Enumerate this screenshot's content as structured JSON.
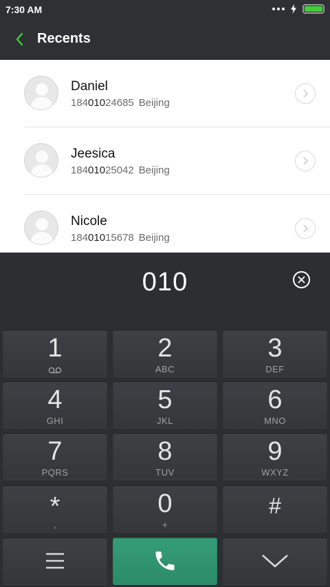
{
  "status": {
    "time": "7:30 AM",
    "battery_level": 1.0
  },
  "header": {
    "title": "Recents"
  },
  "contacts": [
    {
      "name": "Daniel",
      "num_prefix": "184",
      "num_match": "010",
      "num_suffix": "24685",
      "location": "Beijing"
    },
    {
      "name": "Jeesica",
      "num_prefix": "184",
      "num_match": "010",
      "num_suffix": "25042",
      "location": "Beijing"
    },
    {
      "name": "Nicole",
      "num_prefix": "184",
      "num_match": "010",
      "num_suffix": "15678",
      "location": "Beijing"
    }
  ],
  "dialer": {
    "number": "010"
  },
  "keys": [
    {
      "digit": "1",
      "letters": ""
    },
    {
      "digit": "2",
      "letters": "ABC"
    },
    {
      "digit": "3",
      "letters": "DEF"
    },
    {
      "digit": "4",
      "letters": "GHI"
    },
    {
      "digit": "5",
      "letters": "JKL"
    },
    {
      "digit": "6",
      "letters": "MNO"
    },
    {
      "digit": "7",
      "letters": "PQRS"
    },
    {
      "digit": "8",
      "letters": "TUV"
    },
    {
      "digit": "9",
      "letters": "WXYZ"
    },
    {
      "digit": "*",
      "letters": ","
    },
    {
      "digit": "0",
      "letters": "+"
    },
    {
      "digit": "#",
      "letters": ""
    }
  ],
  "icons": {
    "back": "chevron-left-icon",
    "detail": "chevron-right-icon",
    "clear": "clear-icon",
    "voicemail": "voicemail-icon",
    "menu": "menu-icon",
    "call": "phone-icon",
    "collapse": "chevron-down-icon"
  },
  "colors": {
    "accent": "#41cf3a",
    "call": "#2f9470",
    "panel": "#2d2e32"
  }
}
